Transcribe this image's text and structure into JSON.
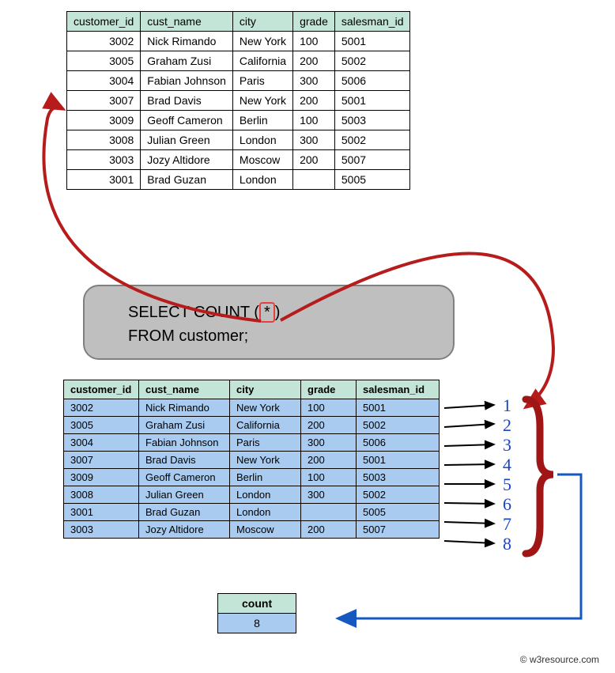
{
  "headers": [
    "customer_id",
    "cust_name",
    "city",
    "grade",
    "salesman_id"
  ],
  "table1_rows": [
    {
      "id": "3002",
      "name": "Nick Rimando",
      "city": "New York",
      "grade": "100",
      "sid": "5001"
    },
    {
      "id": "3005",
      "name": "Graham Zusi",
      "city": "California",
      "grade": "200",
      "sid": "5002"
    },
    {
      "id": "3004",
      "name": "Fabian Johnson",
      "city": "Paris",
      "grade": "300",
      "sid": "5006"
    },
    {
      "id": "3007",
      "name": "Brad Davis",
      "city": "New York",
      "grade": " 200",
      "sid": "5001"
    },
    {
      "id": "3009",
      "name": "Geoff Cameron",
      "city": "Berlin",
      "grade": "100",
      "sid": "5003"
    },
    {
      "id": "3008",
      "name": "Julian Green",
      "city": "London",
      "grade": "300",
      "sid": "5002"
    },
    {
      "id": "3003",
      "name": "Jozy Altidore",
      "city": "Moscow",
      "grade": "200",
      "sid": "5007"
    },
    {
      "id": "3001",
      "name": "Brad Guzan",
      "city": "London",
      "grade": "",
      "sid": "5005"
    }
  ],
  "table2_rows": [
    {
      "id": "3002",
      "name": "Nick Rimando",
      "city": "New York",
      "grade": "100",
      "sid": "5001"
    },
    {
      "id": "3005",
      "name": "Graham Zusi",
      "city": "California",
      "grade": "200",
      "sid": "5002"
    },
    {
      "id": "3004",
      "name": "Fabian Johnson",
      "city": "Paris",
      "grade": "300",
      "sid": "5006"
    },
    {
      "id": "3007",
      "name": "Brad Davis",
      "city": "New York",
      "grade": "200",
      "sid": "5001"
    },
    {
      "id": "3009",
      "name": "Geoff Cameron",
      "city": "Berlin",
      "grade": "100",
      "sid": "5003"
    },
    {
      "id": "3008",
      "name": "Julian Green",
      "city": "London",
      "grade": "300",
      "sid": "5002"
    },
    {
      "id": "3001",
      "name": "Brad Guzan",
      "city": "London",
      "grade": "",
      "sid": "5005"
    },
    {
      "id": "3003",
      "name": "Jozy Altidore",
      "city": "Moscow",
      "grade": "200",
      "sid": "5007"
    }
  ],
  "sql": {
    "line1a": "SELECT COUNT (",
    "star": "*",
    "line1b": ")",
    "line2": "FROM customer;"
  },
  "result": {
    "header": "count",
    "value": "8"
  },
  "rownums": [
    "1",
    "2",
    "3",
    "4",
    "5",
    "6",
    "7",
    "8"
  ],
  "footer": "© w3resource.com"
}
